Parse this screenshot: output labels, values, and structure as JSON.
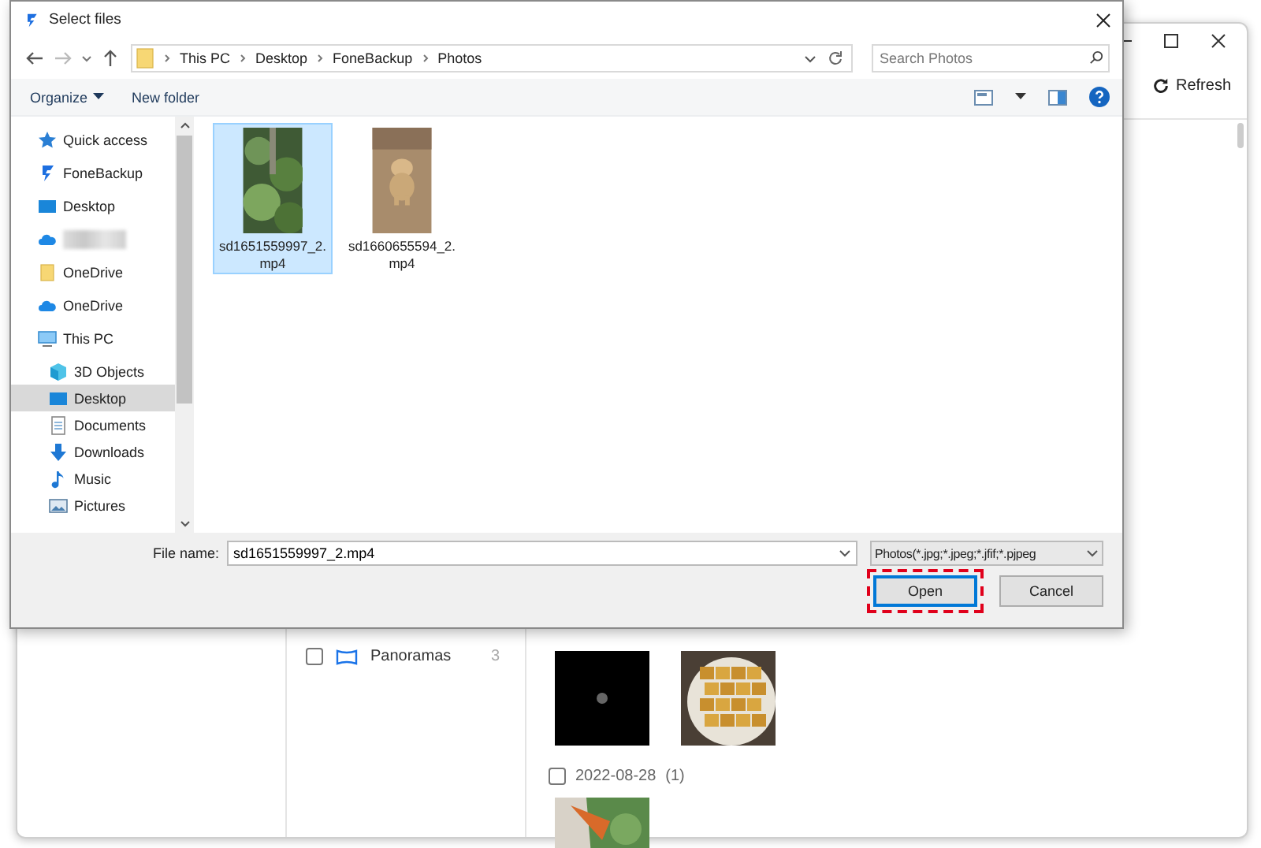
{
  "background_app": {
    "refresh_button": "Refresh",
    "albums": [
      {
        "label": "Panoramas",
        "count": "3",
        "checked": false
      }
    ],
    "photo_groups": [
      {
        "photos": [
          {
            "kind": "picture"
          },
          {
            "kind": "picture"
          }
        ]
      },
      {
        "date": "2022-08-28",
        "count": "(1)",
        "checked": false,
        "photos": [
          {
            "kind": "picture"
          }
        ]
      }
    ]
  },
  "dialog": {
    "title": "Select files",
    "breadcrumb": [
      "This PC",
      "Desktop",
      "FoneBackup",
      "Photos"
    ],
    "search": {
      "placeholder": "Search Photos"
    },
    "toolbar": [
      {
        "label": "Organize",
        "kind": "menu"
      },
      {
        "label": "New folder",
        "kind": "button"
      }
    ],
    "nav": [
      {
        "label": "Quick access",
        "kind": "star",
        "selected": false
      },
      {
        "label": "FoneBackup",
        "kind": "app",
        "selected": false
      },
      {
        "label": "Desktop",
        "kind": "desktop",
        "selected": false
      },
      {
        "kind": "cloud",
        "redacted": true,
        "selected": false
      },
      {
        "label": "OneDrive",
        "kind": "folder",
        "selected": false
      },
      {
        "label": "OneDrive",
        "kind": "cloud",
        "selected": false
      },
      {
        "label": "This PC",
        "kind": "pc",
        "selected": false,
        "children": [
          {
            "label": "3D Objects",
            "kind": "cube",
            "selected": false
          },
          {
            "label": "Desktop",
            "kind": "desktop",
            "selected": true
          },
          {
            "label": "Documents",
            "kind": "document",
            "selected": false
          },
          {
            "label": "Downloads",
            "kind": "download",
            "selected": false
          },
          {
            "label": "Music",
            "kind": "music",
            "selected": false
          },
          {
            "label": "Pictures",
            "kind": "pictures",
            "selected": false
          }
        ]
      }
    ],
    "files": [
      {
        "name": "sd1651559997_2.mp4",
        "selected": true
      },
      {
        "name": "sd1660655594_2.mp4",
        "selected": false
      }
    ],
    "file_name": {
      "label": "File name:",
      "value": "sd1651559997_2.mp4"
    },
    "file_type": "Photos(*.jpg;*.jpeg;*.jfif;*.pjpeg",
    "buttons": [
      {
        "label": "Open",
        "kind": "primary",
        "highlighted": true
      },
      {
        "label": "Cancel",
        "kind": "normal",
        "highlighted": false
      }
    ]
  }
}
